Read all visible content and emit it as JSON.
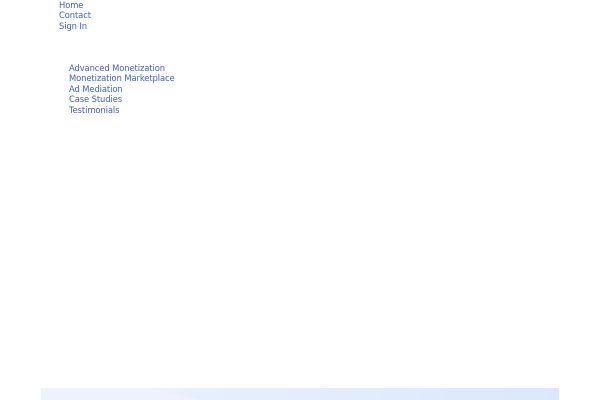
{
  "top_nav": {
    "items": [
      {
        "label": "Home"
      },
      {
        "label": "Contact"
      },
      {
        "label": "Sign In"
      }
    ]
  },
  "product_nav": {
    "items": [
      {
        "label": "Advanced Monetization"
      },
      {
        "label": "Monetization Marketplace"
      },
      {
        "label": "Ad Mediation"
      },
      {
        "label": "Case Studies"
      },
      {
        "label": "Testimonials"
      }
    ]
  },
  "colors": {
    "link": "#3e5fbf",
    "background": "#ffffff",
    "footer_band": "#edf3fd"
  }
}
